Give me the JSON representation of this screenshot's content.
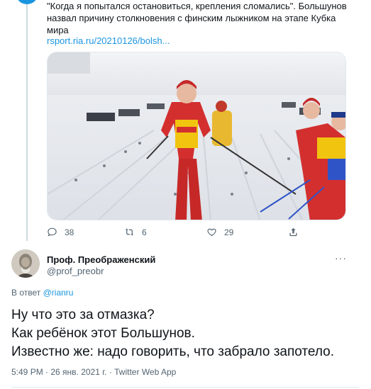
{
  "quoted_tweet": {
    "text": "\"Когда я попытался остановиться, крепления сломались\". Большунов назвал причину столкновения с финским лыжником на этапе Кубка мира",
    "link": "rsport.ria.ru/20210126/bolsh...",
    "stats": {
      "replies": "38",
      "retweets": "6",
      "likes": "29"
    }
  },
  "reply_tweet": {
    "author_name": "Проф. Преображенский",
    "author_handle": "@prof_preobr",
    "reply_prefix": "В ответ",
    "reply_mention": "@rianru",
    "lines": [
      "Ну что это за отмазка?",
      "Как ребёнок этот Большунов.",
      "Известно же: надо говорить, что забрало запотело."
    ],
    "meta": "5:49 PM · 26 янв. 2021 г. · Twitter Web App"
  },
  "icons": {
    "reply": "comment-icon",
    "retweet": "retweet-icon",
    "like": "heart-icon",
    "share": "share-icon",
    "more": "more-icon"
  },
  "colors": {
    "accent": "#1b95e0",
    "secondary_text": "#536471",
    "primary_text": "#0f1419"
  }
}
